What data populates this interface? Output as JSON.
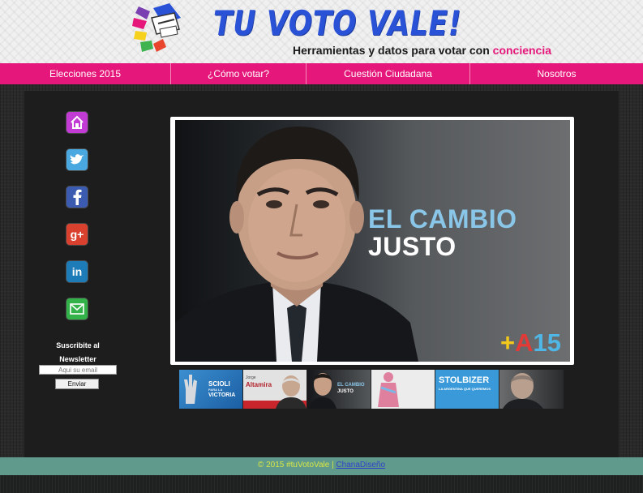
{
  "header": {
    "title": "TU VOTO VALE!",
    "tagline_prefix": "Herramientas y datos para votar con",
    "tagline_accent": "conciencia",
    "logo_icon": "ballot-box-icon",
    "accent_color": "#e5177a",
    "title_color": "#2a52d6"
  },
  "nav": {
    "items": [
      {
        "label": "Elecciones 2015"
      },
      {
        "label": "¿Cómo votar?"
      },
      {
        "label": "Cuestión Ciudadana"
      },
      {
        "label": "Nosotros"
      }
    ]
  },
  "social": {
    "icons": [
      "home-icon",
      "twitter-icon",
      "facebook-icon",
      "google-plus-icon",
      "linkedin-icon",
      "email-icon"
    ]
  },
  "newsletter": {
    "label_line1": "Suscribite al",
    "label_line2": "Newsletter",
    "email_placeholder": "Aqui su email",
    "submit_label": "Enviar"
  },
  "hero": {
    "line1": "EL CAMBIO",
    "line2": "JUSTO",
    "party_plus": "+",
    "party_a": "A",
    "party_num": "15"
  },
  "thumbnails": {
    "items": [
      {
        "line1": "SCIOLI",
        "line2": "PARA LA",
        "line3": "VICTORIA"
      },
      {
        "line1": "Jorge",
        "line2": "Altamira",
        "line3": ""
      },
      {
        "line1": "EL CAMBIO",
        "line2": "JUSTO",
        "line3": ""
      },
      {
        "line1": "",
        "line2": "",
        "line3": ""
      },
      {
        "line1": "STOLBIZER",
        "line2": "LA ARGENTINA QUE QUEREMOS",
        "line3": ""
      },
      {
        "line1": "",
        "line2": "",
        "line3": ""
      }
    ]
  },
  "footer": {
    "copyright": "© 2015 #tuVotoVale |",
    "link": "ChanaDiseño"
  }
}
